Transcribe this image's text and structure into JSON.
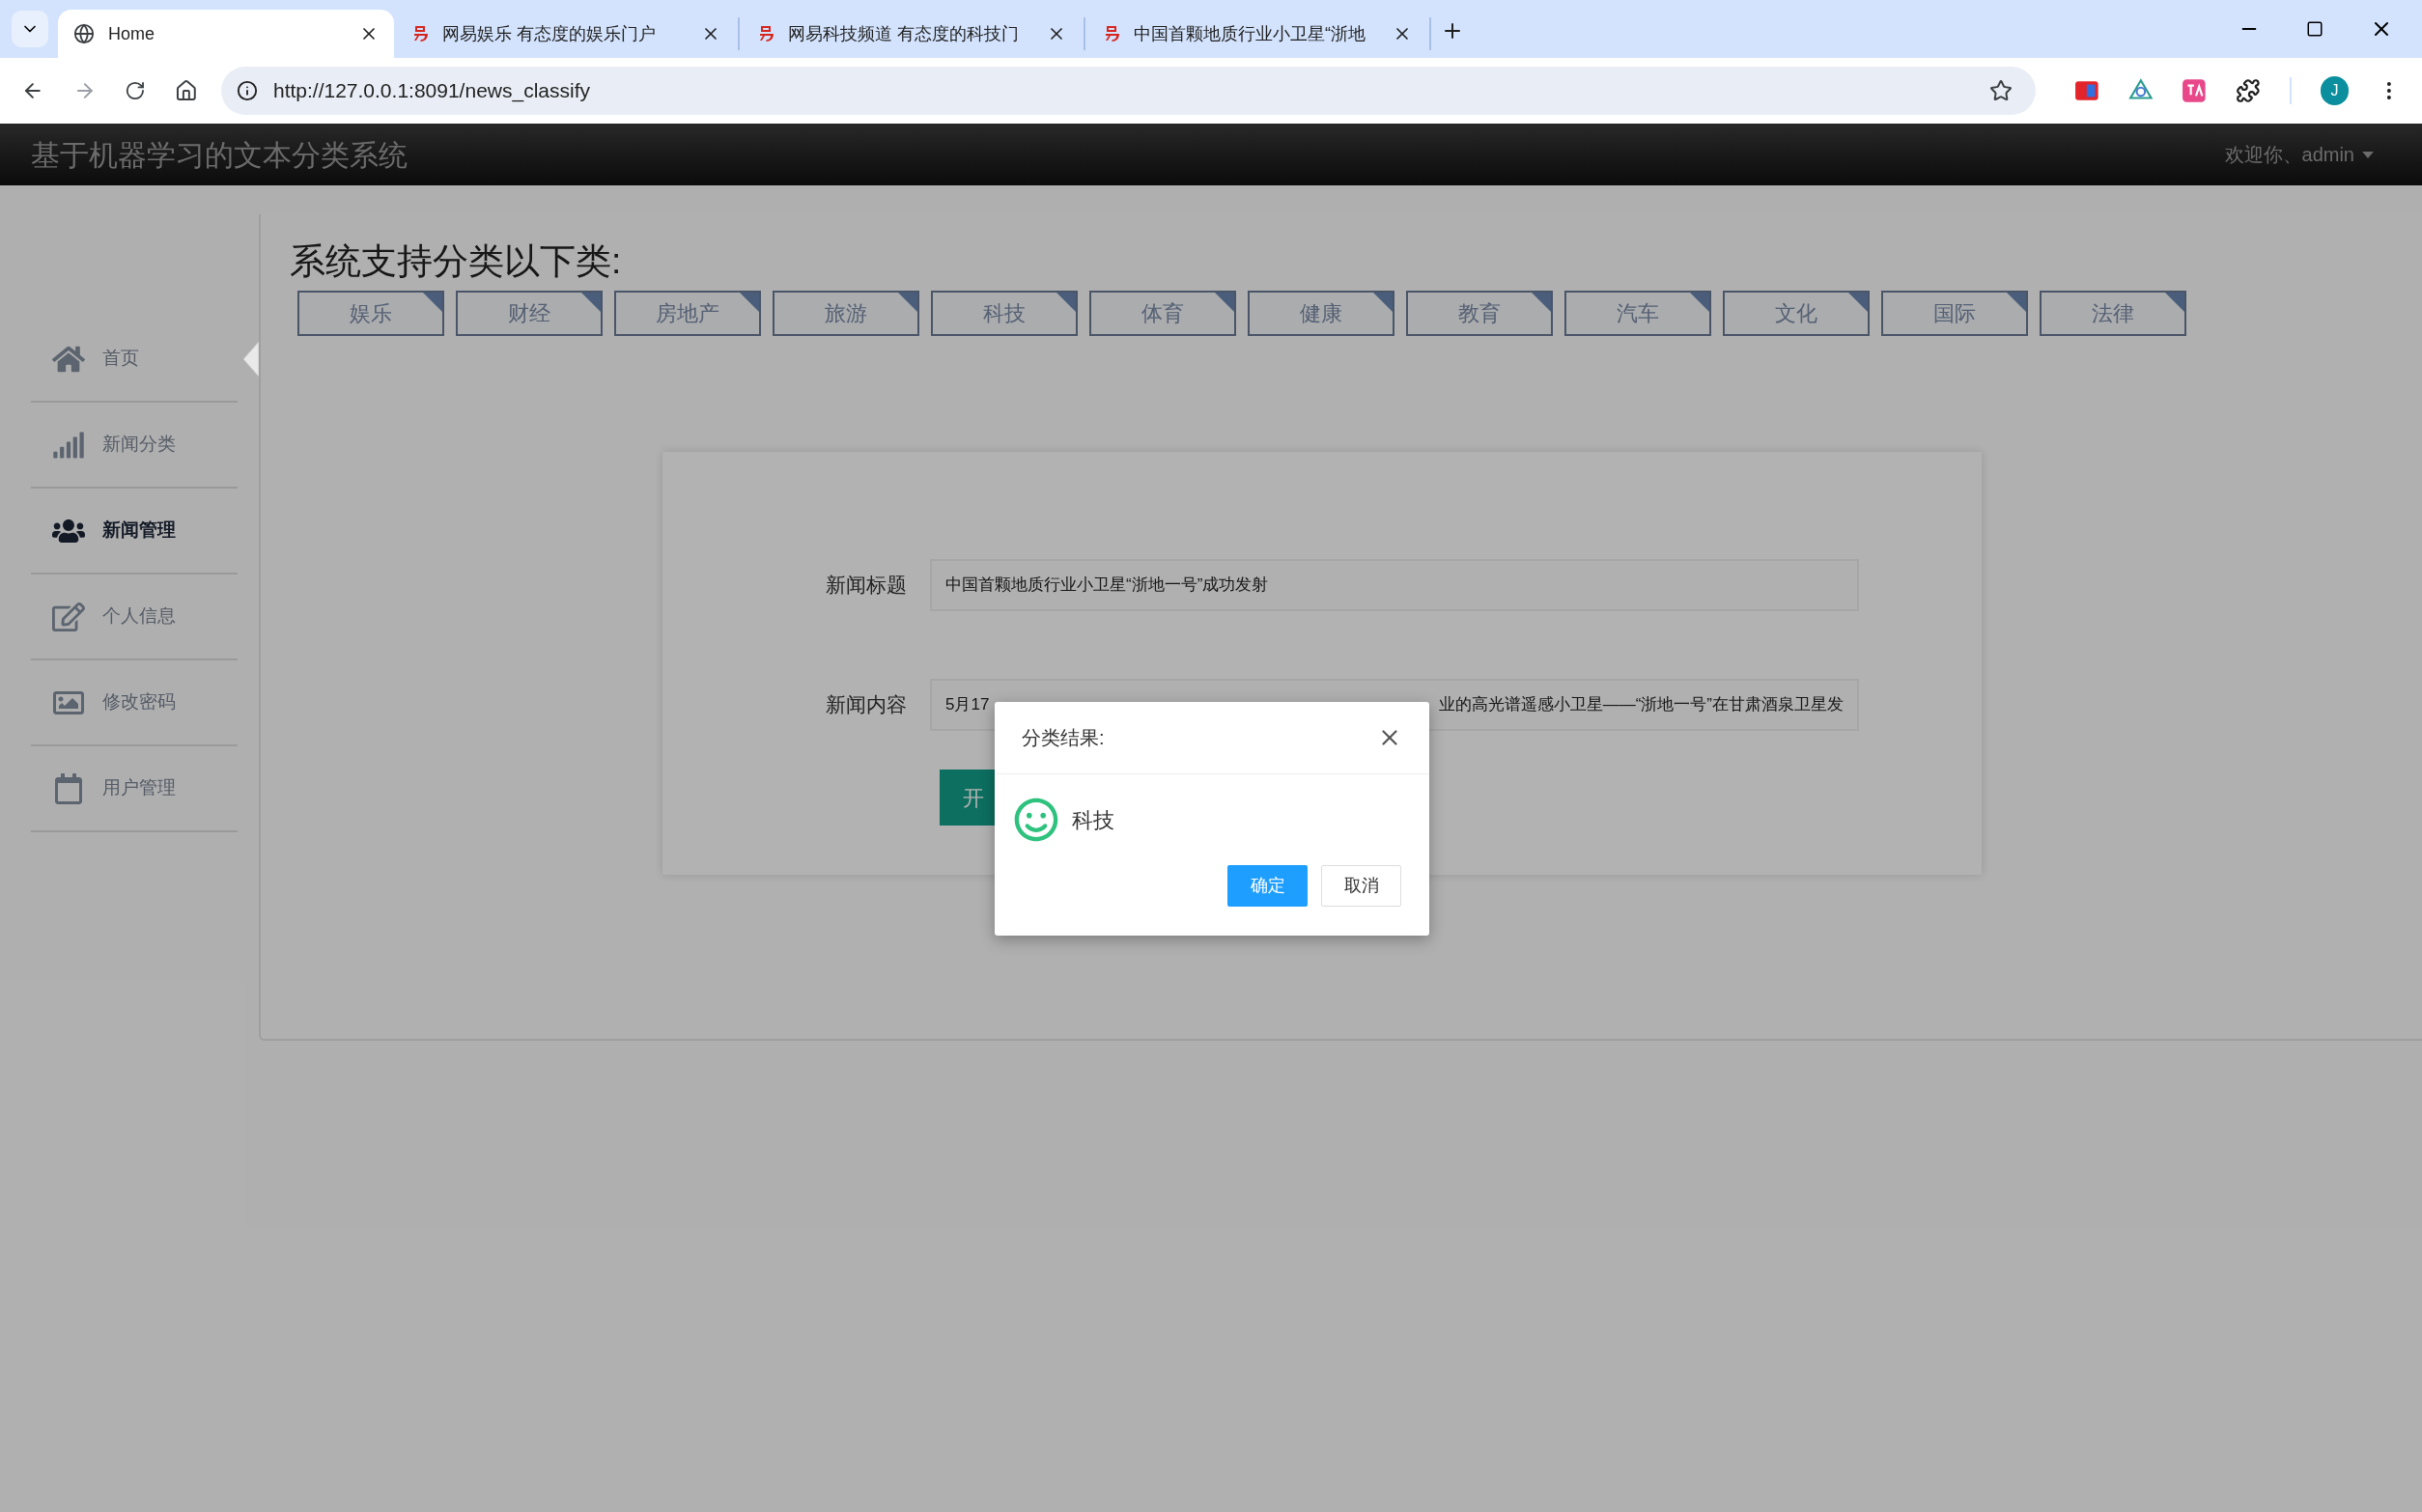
{
  "browser": {
    "tabs": [
      {
        "title": "Home",
        "selected": true
      },
      {
        "title": "网易娱乐 有态度的娱乐门户",
        "selected": false
      },
      {
        "title": "网易科技频道 有态度的科技门",
        "selected": false
      },
      {
        "title": "中国首颗地质行业小卫星“浙地",
        "selected": false
      }
    ],
    "url": "http://127.0.0.1:8091/news_classify",
    "profile": "J"
  },
  "header": {
    "title": "基于机器学习的文本分类系统",
    "user": "欢迎你、admin"
  },
  "sidebar": {
    "items": [
      {
        "label": "首页",
        "selected": false,
        "pointer": true
      },
      {
        "label": "新闻分类",
        "selected": false,
        "pointer": false
      },
      {
        "label": "新闻管理",
        "selected": true,
        "pointer": false
      },
      {
        "label": "个人信息",
        "selected": false,
        "pointer": false
      },
      {
        "label": "修改密码",
        "selected": false,
        "pointer": false
      },
      {
        "label": "用户管理",
        "selected": false,
        "pointer": false
      }
    ]
  },
  "main": {
    "heading": "系统支持分类以下类:",
    "categories": [
      "娱乐",
      "财经",
      "房地产",
      "旅游",
      "科技",
      "体育",
      "健康",
      "教育",
      "汽车",
      "文化",
      "国际",
      "法律"
    ],
    "form": {
      "title_label": "新闻标题",
      "title_value": "中国首颗地质行业小卫星“浙地一号”成功发射",
      "content_label": "新闻内容",
      "content_value_start": "5月17",
      "content_value_end": "业的高光谱遥感小卫星——“浙地一号”在甘肃酒泉卫星发",
      "submit": "开"
    }
  },
  "dialog": {
    "title": "分类结果:",
    "result": "科技",
    "ok": "确定",
    "cancel": "取消"
  }
}
